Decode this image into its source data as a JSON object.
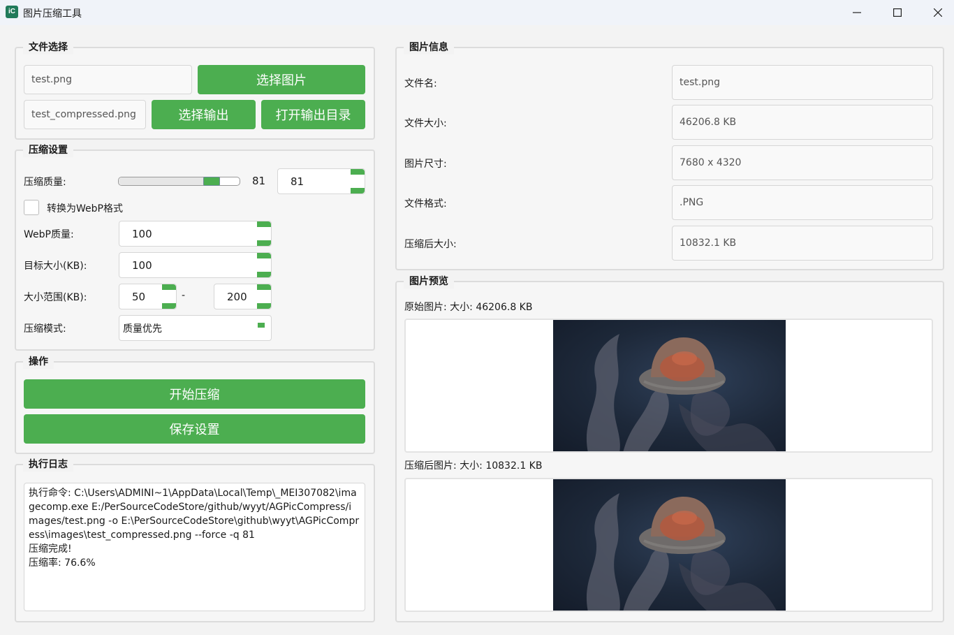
{
  "window": {
    "title": "图片压缩工具",
    "icon_text": "iC"
  },
  "file_select": {
    "title": "文件选择",
    "input_file": "test.png",
    "select_image_button": "选择图片",
    "output_file": "test_compressed.png",
    "select_output_button": "选择输出",
    "open_output_dir_button": "打开输出目录"
  },
  "compress_settings": {
    "title": "压缩设置",
    "quality_label": "压缩质量:",
    "quality_slider_value": 81,
    "quality_slider_max": 100,
    "quality_display": "81",
    "quality_spin": "81",
    "webp_checkbox_label": "转换为WebP格式",
    "webp_checked": false,
    "webp_quality_label": "WebP质量:",
    "webp_quality": "100",
    "target_size_label": "目标大小(KB):",
    "target_size": "100",
    "size_range_label": "大小范围(KB):",
    "size_range_min": "50",
    "size_range_sep": "-",
    "size_range_max": "200",
    "mode_label": "压缩模式:",
    "mode_value": "质量优先"
  },
  "operations": {
    "title": "操作",
    "start_button": "开始压缩",
    "save_button": "保存设置"
  },
  "log": {
    "title": "执行日志",
    "lines": [
      "执行命令: C:\\Users\\ADMINI~1\\AppData\\Local\\Temp\\_MEI307082\\imagecomp.exe E:/PerSourceCodeStore/github/wyyt/AGPicCompress/images/test.png -o E:\\PerSourceCodeStore\\github\\wyyt\\AGPicCompress\\images\\test_compressed.png --force -q 81",
      "压缩完成!",
      "压缩率: 76.6%"
    ]
  },
  "image_info": {
    "title": "图片信息",
    "filename_label": "文件名:",
    "filename": "test.png",
    "filesize_label": "文件大小:",
    "filesize": "46206.8 KB",
    "dimensions_label": "图片尺寸:",
    "dimensions": "7680 x 4320",
    "format_label": "文件格式:",
    "format": ".PNG",
    "compressed_size_label": "压缩后大小:",
    "compressed_size": "10832.1 KB"
  },
  "preview": {
    "title": "图片预览",
    "original_label": "原始图片: 大小: 46206.8 KB",
    "compressed_label": "压缩后图片: 大小: 10832.1 KB"
  },
  "colors": {
    "accent": "#4cae50",
    "panel_border": "#dcdcdc",
    "app_icon": "#217a5a"
  }
}
